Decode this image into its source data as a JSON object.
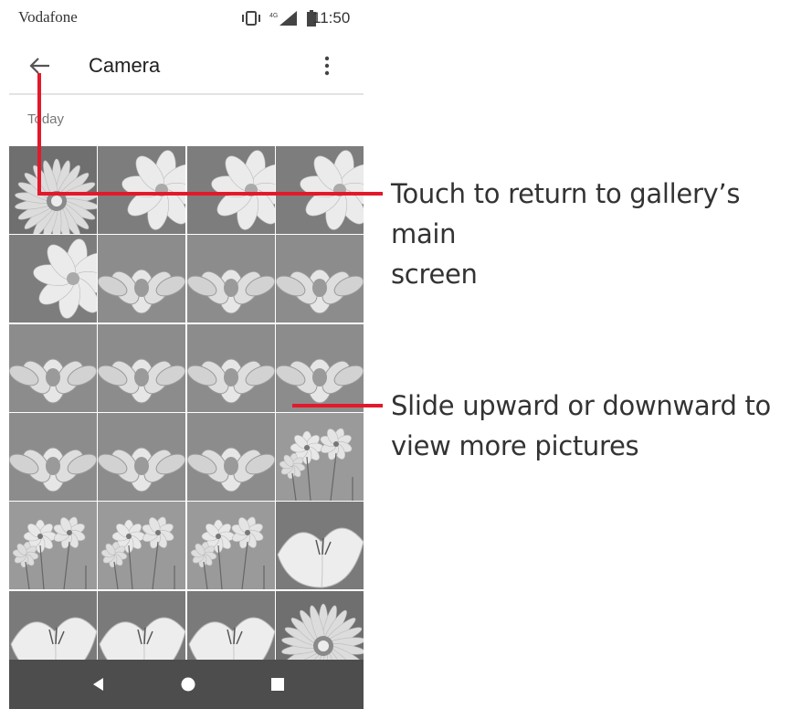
{
  "status_bar": {
    "carrier": "Vodafone",
    "network": "4G",
    "time": "11:50"
  },
  "app_bar": {
    "title": "Camera",
    "back_icon": "arrow-left-icon",
    "menu_icon": "more-vert-icon"
  },
  "section": {
    "label": "Today"
  },
  "grid": {
    "rows": [
      [
        "daisy",
        "cosmos",
        "cosmos",
        "cosmos"
      ],
      [
        "cosmos",
        "lotus",
        "lotus",
        "lotus"
      ],
      [
        "lotus",
        "lotus",
        "lotus",
        "lotus"
      ],
      [
        "lotus",
        "lotus",
        "lotus",
        "cosmos-field"
      ],
      [
        "cosmos-field",
        "cosmos-field",
        "cosmos-field",
        "lily"
      ],
      [
        "lily",
        "lily",
        "lily",
        "daisy"
      ]
    ]
  },
  "nav_bar": {
    "back_icon": "triangle-back-icon",
    "home_icon": "circle-home-icon",
    "recents_icon": "square-recents-icon"
  },
  "annotations": {
    "color": "#e3192b",
    "back_callout": [
      "Touch to return to gallery’s main",
      "screen"
    ],
    "scroll_callout": [
      "Slide upward or downward to",
      "view more pictures"
    ]
  }
}
